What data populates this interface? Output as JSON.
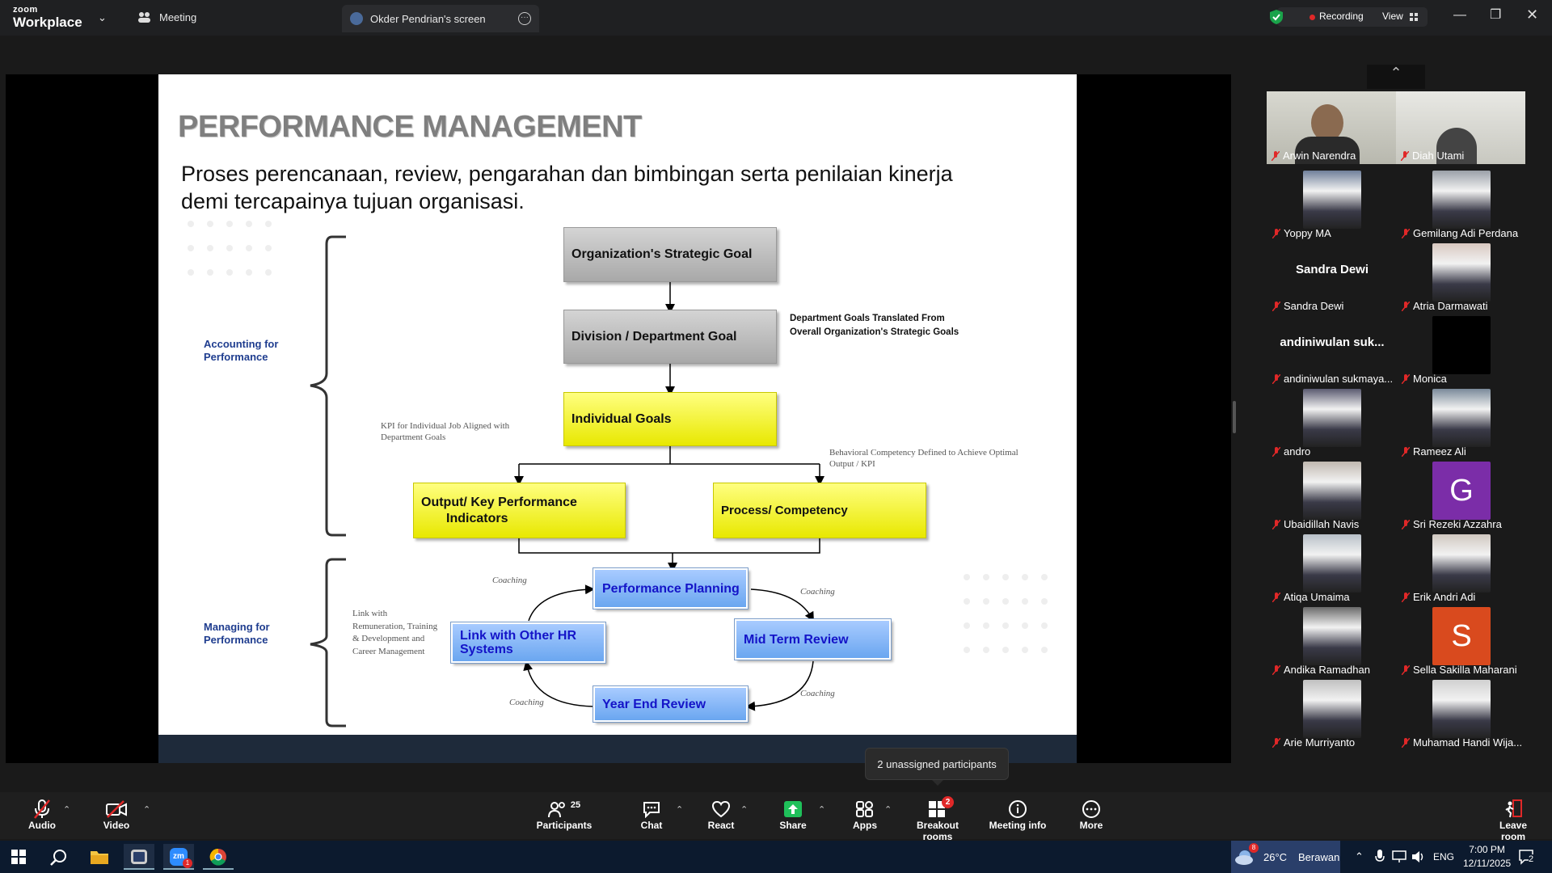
{
  "app": {
    "brand_top": "zoom",
    "brand_bottom": "Workplace"
  },
  "titlebar": {
    "meeting_tab": "Meeting",
    "share_tab": "Okder Pendrian's screen",
    "recording": "Recording",
    "view": "View"
  },
  "slide": {
    "title": "PERFORMANCE MANAGEMENT",
    "subtitle": "Proses perencanaan, review, pengarahan dan bimbingan serta penilaian kinerja demi tercapainya tujuan organisasi.",
    "accounting_label": "Accounting for Performance",
    "managing_label": "Managing for Performance",
    "org_goal": "Organization's Strategic  Goal",
    "div_goal": "Division / Department Goal",
    "dept_note": "Department  Goals Translated From Overall Organization's Strategic Goals",
    "individual_goals": "Individual Goals",
    "kpi_note": "KPI for Individual Job Aligned with Department Goals",
    "behavior_note": "Behavioral Competency Defined to Achieve Optimal Output / KPI",
    "output_kpi_1": "Output/ Key Performance",
    "output_kpi_2": "Indicators",
    "process_comp": "Process/ Competency",
    "perf_planning": "Performance Planning",
    "mid_term": "Mid Term Review",
    "year_end": "Year End Review",
    "link_hr": "Link with Other HR Systems",
    "link_note": "Link with Remuneration, Training & Development and Career Management",
    "coaching": "Coaching"
  },
  "participants": [
    {
      "name": "Arwin Narendra",
      "type": "video"
    },
    {
      "name": "Diah Utami",
      "type": "video"
    },
    {
      "name": "Yoppy MA",
      "type": "photo"
    },
    {
      "name": "Gemilang Adi Perdana",
      "type": "photo"
    },
    {
      "name": "Sandra Dewi",
      "type": "text",
      "display": "Sandra Dewi"
    },
    {
      "name": "Atria Darmawati",
      "type": "photo"
    },
    {
      "name": "andiniwulan sukmaya...",
      "type": "text",
      "display": "andiniwulan  suk..."
    },
    {
      "name": "Monica",
      "type": "black"
    },
    {
      "name": "andro",
      "type": "photo"
    },
    {
      "name": "Rameez Ali",
      "type": "photo"
    },
    {
      "name": "Ubaidillah Navis",
      "type": "photo"
    },
    {
      "name": "Sri Rezeki Azzahra",
      "type": "initial",
      "initial": "G",
      "color": "#7b2da8"
    },
    {
      "name": "Atiqa Umaima",
      "type": "photo"
    },
    {
      "name": "Erik Andri Adi",
      "type": "photo"
    },
    {
      "name": "Andika Ramadhan",
      "type": "photo"
    },
    {
      "name": "Sella Sakilla Maharani",
      "type": "initial",
      "initial": "S",
      "color": "#d94a1e"
    },
    {
      "name": "Arie Murriyanto",
      "type": "photo"
    },
    {
      "name": "Muhamad Handi Wija...",
      "type": "photo"
    }
  ],
  "toolbar": {
    "audio": "Audio",
    "video": "Video",
    "participants": "Participants",
    "participants_count": "25",
    "chat": "Chat",
    "react": "React",
    "share": "Share",
    "apps": "Apps",
    "breakout": "Breakout rooms",
    "breakout_badge": "2",
    "meeting_info": "Meeting info",
    "more": "More",
    "leave": "Leave room",
    "tooltip": "2 unassigned participants"
  },
  "taskbar": {
    "weather_temp": "26°C",
    "weather_text": "Berawan",
    "weather_badge": "8",
    "lang": "ENG",
    "time": "7:00 PM",
    "date": "12/11/2025",
    "notif": "2",
    "zoom_badge": "1"
  },
  "colors": {
    "accent_green": "#1aa34a",
    "recording_red": "#e02828",
    "share_green": "#1fc05a",
    "badge_red": "#e02828"
  }
}
